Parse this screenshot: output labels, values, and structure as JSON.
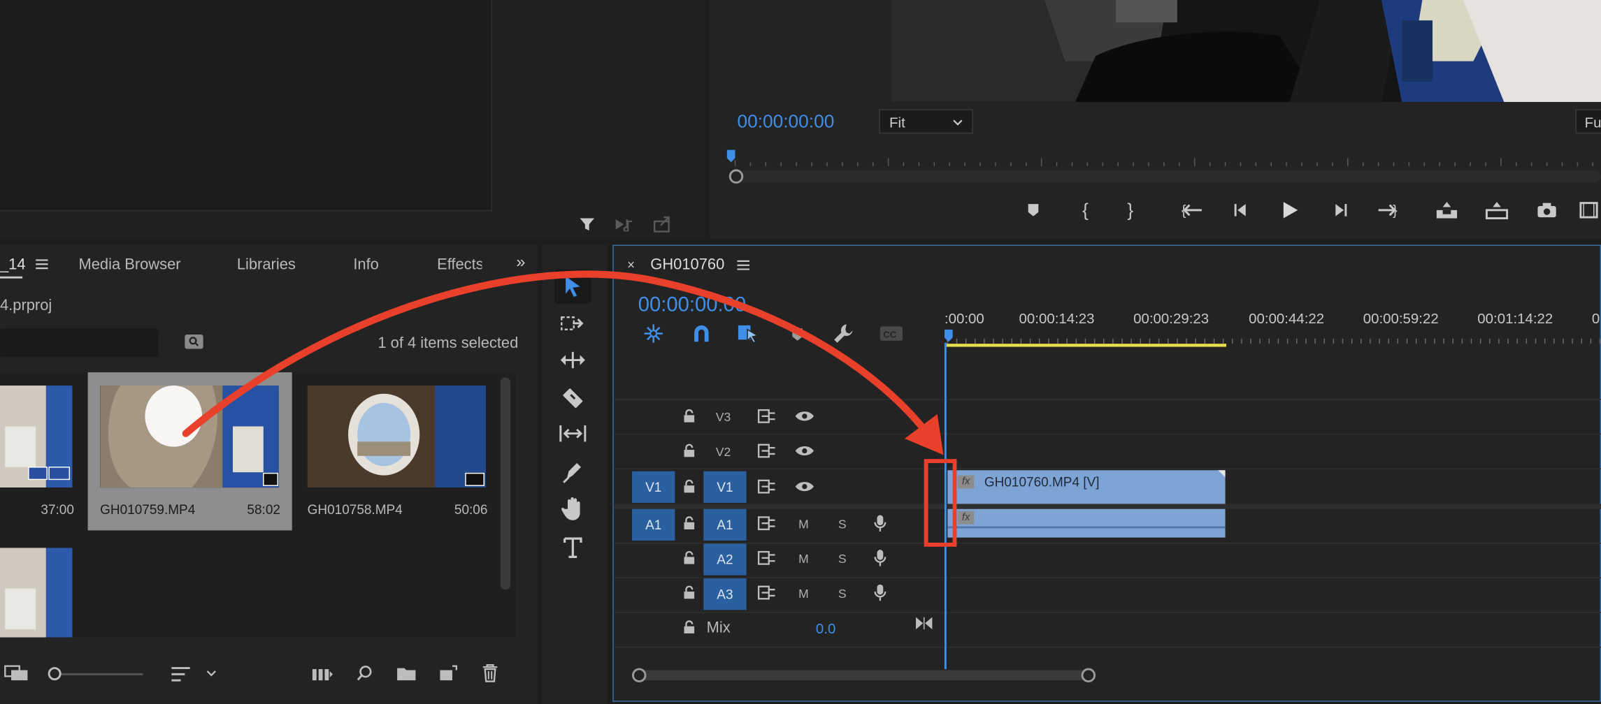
{
  "source_monitor": {
    "timecode": "00:00:00:00",
    "fit_option": "Fit",
    "full_option": "Fu"
  },
  "project_panel": {
    "tabs": [
      {
        "label": "_14",
        "active": true
      },
      {
        "label": "Media Browser"
      },
      {
        "label": "Libraries"
      },
      {
        "label": "Info"
      },
      {
        "label": "Effects"
      }
    ],
    "project_file": "4.prproj",
    "selection_status": "1 of 4 items selected",
    "items": [
      {
        "name": "",
        "duration": "37:00"
      },
      {
        "name": "GH010759.MP4",
        "duration": "58:02",
        "selected": true
      },
      {
        "name": "GH010758.MP4",
        "duration": "50:06"
      }
    ]
  },
  "timeline": {
    "sequence_name": "GH010760",
    "timecode": "00:00:00:00",
    "ruler_ticks": [
      ":00:00",
      "00:00:14:23",
      "00:00:29:23",
      "00:00:44:22",
      "00:00:59:22",
      "00:01:14:22",
      "0"
    ],
    "video_tracks": [
      {
        "source": "",
        "label": "V3"
      },
      {
        "source": "",
        "label": "V2"
      },
      {
        "source": "V1",
        "label": "V1"
      }
    ],
    "audio_tracks": [
      {
        "source": "A1",
        "label": "A1",
        "m": "M",
        "s": "S"
      },
      {
        "source": "",
        "label": "A2",
        "m": "M",
        "s": "S"
      },
      {
        "source": "",
        "label": "A3",
        "m": "M",
        "s": "S"
      }
    ],
    "mix_label": "Mix",
    "mix_value": "0.0",
    "clip_label": "GH010760.MP4 [V]",
    "fx_label": "fx"
  },
  "colors": {
    "accent": "#3f8ee8",
    "clip": "#7ea3d5",
    "track_active": "#2a5fa0",
    "annotation": "#e8402a",
    "work_area": "#e8e04a"
  }
}
